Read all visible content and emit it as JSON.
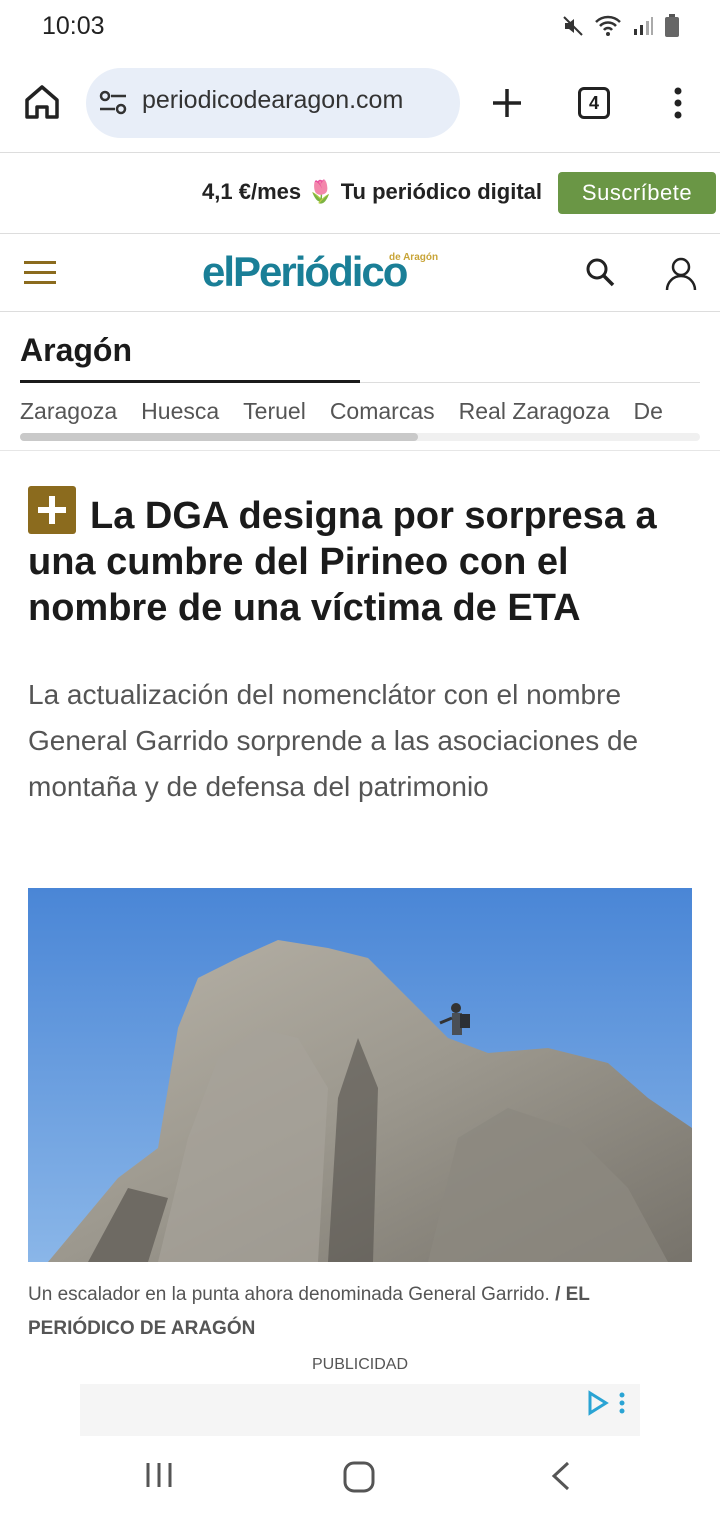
{
  "status_bar": {
    "time": "10:03"
  },
  "browser": {
    "url": "periodicodearagon.com",
    "tab_count": "4"
  },
  "promo": {
    "text": "4,1 €/mes 🌷 Tu periódico digital",
    "subscribe_label": "Suscríbete",
    "subscribe_color": "#6a9645"
  },
  "site": {
    "logo": "elPeriódico",
    "logo_sub": "de Aragón",
    "brand_color": "#1a7f97",
    "accent_color": "#8b6b1e"
  },
  "section": {
    "title": "Aragón",
    "subnav": [
      "Zaragoza",
      "Huesca",
      "Teruel",
      "Comarcas",
      "Real Zaragoza",
      "De"
    ]
  },
  "article": {
    "headline": "La DGA designa por sorpresa a una cumbre del Pirineo con el nombre de una víctima de ETA",
    "lead": "La actualización del nomenclátor con el nombre General Garrido sorprende a las asociaciones de montaña y de defensa del patrimonio",
    "caption": "Un escalador en la punta ahora denominada General Garrido.",
    "caption_credit": "/ EL PERIÓDICO DE ARAGÓN"
  },
  "ad": {
    "label": "PUBLICIDAD"
  },
  "icons": {
    "home": "home-icon",
    "site_settings": "tune-icon",
    "new_tab": "plus-icon",
    "tabs": "tabs-icon",
    "more": "more-vertical-icon",
    "menu": "hamburger-icon",
    "search": "search-icon",
    "account": "user-icon",
    "premium": "plus-badge-icon"
  }
}
